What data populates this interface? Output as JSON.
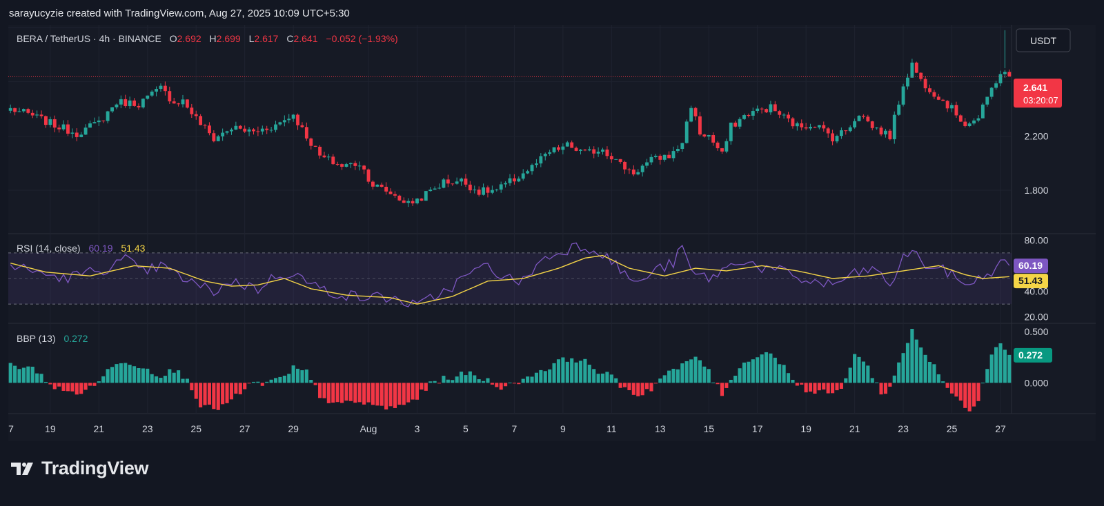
{
  "credit": "sarayucyzie created with TradingView.com, Aug 27, 2025 10:09 UTC+5:30",
  "brand": "TradingView",
  "colors": {
    "up": "#26a69a",
    "down": "#f23645",
    "rsi": "#7e57c2",
    "rsi_ma": "#f5d547",
    "bbp_up": "#26a69a",
    "bbp_down": "#f23645"
  },
  "chart_data": [
    {
      "type": "candlestick",
      "legend": {
        "symbol": "BERA / TetherUS · 4h · BINANCE",
        "o_label": "O",
        "o": "2.692",
        "h_label": "H",
        "h": "2.699",
        "l_label": "L",
        "l": "2.617",
        "c_label": "C",
        "c": "2.641",
        "change": "−0.052 (−1.93%)"
      },
      "currency_button": "USDT",
      "last_price": "2.641",
      "countdown": "03:20:07",
      "y_ticks": [
        "2.200",
        "1.800"
      ],
      "y_tick_values": [
        2.2,
        1.8
      ],
      "ylim": [
        1.48,
        3.02
      ],
      "close_anchors": [
        [
          0,
          2.4
        ],
        [
          5,
          2.35
        ],
        [
          10,
          2.28
        ],
        [
          15,
          2.22
        ],
        [
          20,
          2.3
        ],
        [
          24,
          2.45
        ],
        [
          29,
          2.44
        ],
        [
          34,
          2.55
        ],
        [
          37,
          2.45
        ],
        [
          39,
          2.46
        ],
        [
          42,
          2.33
        ],
        [
          46,
          2.18
        ],
        [
          50,
          2.26
        ],
        [
          55,
          2.23
        ],
        [
          60,
          2.28
        ],
        [
          64,
          2.36
        ],
        [
          66,
          2.25
        ],
        [
          70,
          2.05
        ],
        [
          75,
          1.98
        ],
        [
          79,
          2.0
        ],
        [
          82,
          1.84
        ],
        [
          86,
          1.78
        ],
        [
          90,
          1.7
        ],
        [
          93,
          1.75
        ],
        [
          98,
          1.86
        ],
        [
          102,
          1.87
        ],
        [
          106,
          1.79
        ],
        [
          110,
          1.8
        ],
        [
          114,
          1.88
        ],
        [
          118,
          1.97
        ],
        [
          122,
          2.08
        ],
        [
          126,
          2.13
        ],
        [
          130,
          2.07
        ],
        [
          134,
          2.11
        ],
        [
          138,
          1.99
        ],
        [
          141,
          1.93
        ],
        [
          145,
          2.02
        ],
        [
          150,
          2.07
        ],
        [
          152,
          2.16
        ],
        [
          154,
          2.43
        ],
        [
          156,
          2.22
        ],
        [
          158,
          2.2
        ],
        [
          161,
          2.06
        ],
        [
          163,
          2.27
        ],
        [
          167,
          2.37
        ],
        [
          172,
          2.41
        ],
        [
          174,
          2.36
        ],
        [
          178,
          2.27
        ],
        [
          182,
          2.29
        ],
        [
          186,
          2.19
        ],
        [
          189,
          2.24
        ],
        [
          192,
          2.37
        ],
        [
          195,
          2.27
        ],
        [
          199,
          2.2
        ],
        [
          202,
          2.58
        ],
        [
          204,
          2.73
        ],
        [
          206,
          2.61
        ],
        [
          210,
          2.49
        ],
        [
          213,
          2.4
        ],
        [
          216,
          2.29
        ],
        [
          219,
          2.33
        ],
        [
          222,
          2.55
        ],
        [
          224,
          2.67
        ],
        [
          226,
          2.641
        ]
      ],
      "x_tick_labels": [
        "7",
        "19",
        "21",
        "23",
        "25",
        "27",
        "29",
        "Aug",
        "3",
        "5",
        "7",
        "9",
        "11",
        "13",
        "15",
        "17",
        "19",
        "21",
        "23",
        "25",
        "27"
      ],
      "x_tick_bars": [
        -2,
        9,
        20,
        31,
        42,
        53,
        64,
        81,
        92,
        103,
        114,
        125,
        136,
        147,
        158,
        169,
        180,
        191,
        202,
        213,
        224
      ]
    },
    {
      "type": "line",
      "legend": {
        "label": "RSI (14, close)",
        "rsi": "60.19",
        "ma": "51.43"
      },
      "y_ticks": [
        "80.00",
        "40.00",
        "20.00"
      ],
      "y_tick_values": [
        80,
        40,
        20
      ],
      "bands": [
        70,
        50,
        30
      ],
      "ylim": [
        15,
        85
      ],
      "series": [
        {
          "name": "RSI",
          "last": "60.19",
          "anchors": [
            [
              0,
              60
            ],
            [
              6,
              55
            ],
            [
              12,
              50
            ],
            [
              18,
              55
            ],
            [
              22,
              58
            ],
            [
              26,
              65
            ],
            [
              30,
              55
            ],
            [
              34,
              60
            ],
            [
              38,
              52
            ],
            [
              42,
              45
            ],
            [
              46,
              40
            ],
            [
              50,
              48
            ],
            [
              56,
              42
            ],
            [
              60,
              52
            ],
            [
              64,
              55
            ],
            [
              68,
              45
            ],
            [
              72,
              40
            ],
            [
              76,
              37
            ],
            [
              80,
              35
            ],
            [
              84,
              36
            ],
            [
              88,
              33
            ],
            [
              92,
              28
            ],
            [
              96,
              36
            ],
            [
              100,
              44
            ],
            [
              104,
              54
            ],
            [
              108,
              60
            ],
            [
              112,
              50
            ],
            [
              116,
              48
            ],
            [
              120,
              64
            ],
            [
              124,
              70
            ],
            [
              128,
              76
            ],
            [
              131,
              74
            ],
            [
              134,
              70
            ],
            [
              138,
              57
            ],
            [
              142,
              45
            ],
            [
              145,
              55
            ],
            [
              150,
              62
            ],
            [
              152,
              75
            ],
            [
              154,
              55
            ],
            [
              158,
              50
            ],
            [
              162,
              58
            ],
            [
              166,
              65
            ],
            [
              170,
              58
            ],
            [
              175,
              55
            ],
            [
              180,
              48
            ],
            [
              186,
              45
            ],
            [
              190,
              52
            ],
            [
              195,
              58
            ],
            [
              199,
              45
            ],
            [
              202,
              65
            ],
            [
              204,
              74
            ],
            [
              206,
              62
            ],
            [
              212,
              55
            ],
            [
              216,
              46
            ],
            [
              220,
              50
            ],
            [
              224,
              62
            ],
            [
              226,
              60.19
            ]
          ]
        },
        {
          "name": "RSI-based MA",
          "last": "51.43",
          "anchors": [
            [
              0,
              62
            ],
            [
              8,
              55
            ],
            [
              18,
              52
            ],
            [
              28,
              60
            ],
            [
              36,
              58
            ],
            [
              44,
              48
            ],
            [
              50,
              44
            ],
            [
              56,
              45
            ],
            [
              62,
              50
            ],
            [
              68,
              42
            ],
            [
              76,
              37
            ],
            [
              86,
              35
            ],
            [
              92,
              30
            ],
            [
              100,
              36
            ],
            [
              108,
              48
            ],
            [
              116,
              50
            ],
            [
              124,
              58
            ],
            [
              130,
              66
            ],
            [
              134,
              68
            ],
            [
              140,
              58
            ],
            [
              148,
              52
            ],
            [
              155,
              58
            ],
            [
              162,
              56
            ],
            [
              170,
              60
            ],
            [
              178,
              56
            ],
            [
              186,
              50
            ],
            [
              194,
              52
            ],
            [
              200,
              55
            ],
            [
              206,
              58
            ],
            [
              210,
              60
            ],
            [
              216,
              53
            ],
            [
              220,
              50
            ],
            [
              226,
              51.43
            ]
          ]
        }
      ]
    },
    {
      "type": "bar",
      "legend": {
        "label": "BBP (13)",
        "value": "0.272"
      },
      "y_ticks": [
        "0.500",
        "0.000"
      ],
      "y_tick_values": [
        0.5,
        0
      ],
      "last": "0.272",
      "ylim": [
        -0.3,
        0.58
      ],
      "anchors": [
        [
          0,
          0.18
        ],
        [
          6,
          0.12
        ],
        [
          10,
          -0.05
        ],
        [
          14,
          -0.1
        ],
        [
          18,
          -0.06
        ],
        [
          22,
          0.12
        ],
        [
          26,
          0.22
        ],
        [
          30,
          0.15
        ],
        [
          34,
          0.08
        ],
        [
          37,
          0.12
        ],
        [
          40,
          0.05
        ],
        [
          43,
          -0.22
        ],
        [
          46,
          -0.26
        ],
        [
          50,
          -0.18
        ],
        [
          54,
          -0.02
        ],
        [
          58,
          0.0
        ],
        [
          62,
          0.05
        ],
        [
          64,
          0.14
        ],
        [
          67,
          0.1
        ],
        [
          70,
          -0.12
        ],
        [
          74,
          -0.22
        ],
        [
          78,
          -0.18
        ],
        [
          82,
          -0.22
        ],
        [
          86,
          -0.25
        ],
        [
          90,
          -0.2
        ],
        [
          93,
          -0.1
        ],
        [
          96,
          0.02
        ],
        [
          100,
          0.06
        ],
        [
          104,
          0.09
        ],
        [
          108,
          0.02
        ],
        [
          112,
          -0.05
        ],
        [
          116,
          0.04
        ],
        [
          120,
          0.12
        ],
        [
          124,
          0.2
        ],
        [
          127,
          0.25
        ],
        [
          130,
          0.2
        ],
        [
          133,
          0.12
        ],
        [
          136,
          0.05
        ],
        [
          139,
          -0.05
        ],
        [
          142,
          -0.12
        ],
        [
          145,
          -0.05
        ],
        [
          148,
          0.08
        ],
        [
          152,
          0.16
        ],
        [
          155,
          0.26
        ],
        [
          157,
          0.18
        ],
        [
          159,
          0.02
        ],
        [
          161,
          -0.1
        ],
        [
          164,
          0.1
        ],
        [
          168,
          0.26
        ],
        [
          172,
          0.3
        ],
        [
          174,
          0.2
        ],
        [
          177,
          0.05
        ],
        [
          180,
          -0.08
        ],
        [
          184,
          -0.1
        ],
        [
          188,
          -0.08
        ],
        [
          191,
          0.3
        ],
        [
          194,
          0.15
        ],
        [
          197,
          -0.1
        ],
        [
          199,
          -0.05
        ],
        [
          202,
          0.3
        ],
        [
          204,
          0.52
        ],
        [
          206,
          0.35
        ],
        [
          209,
          0.15
        ],
        [
          212,
          -0.05
        ],
        [
          215,
          -0.2
        ],
        [
          217,
          -0.25
        ],
        [
          219,
          -0.15
        ],
        [
          222,
          0.3
        ],
        [
          224,
          0.42
        ],
        [
          226,
          0.272
        ]
      ]
    }
  ]
}
